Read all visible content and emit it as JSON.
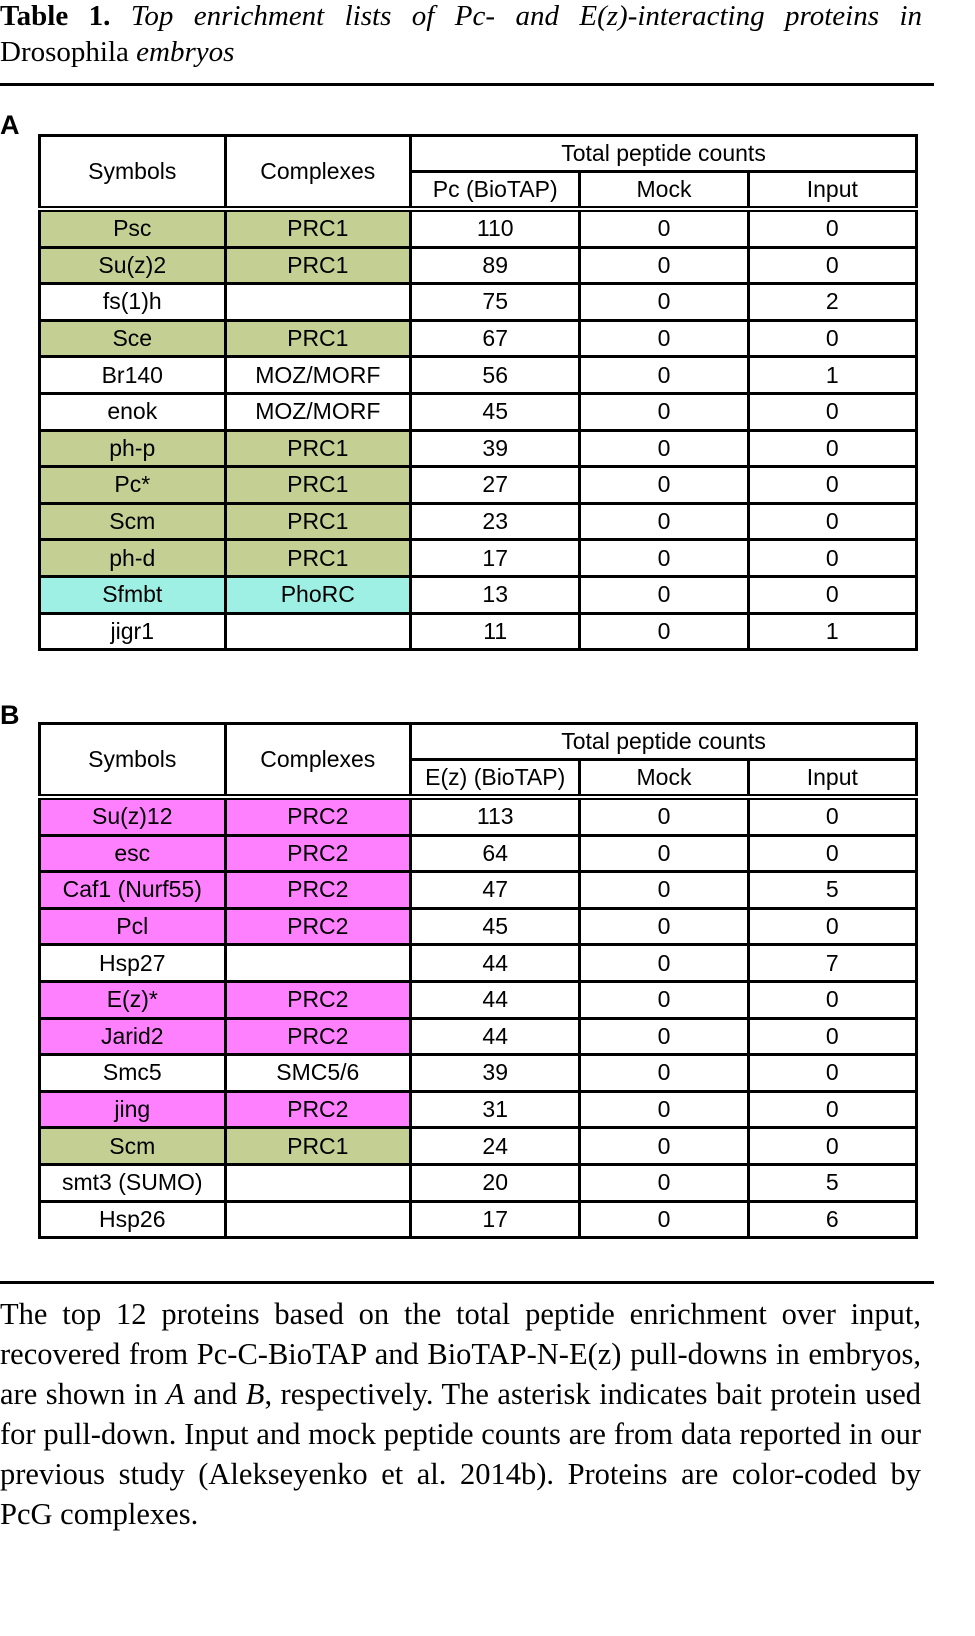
{
  "title": {
    "label": "Table 1.",
    "text_part1": "Top enrichment lists of Pc- and E(z)-interacting proteins in",
    "organism": "Drosophila",
    "text_part2": "embryos"
  },
  "legend": {
    "PRC1": "#c4cf93",
    "PRC2": "#ff80ff",
    "PhoRC": "#9ef0e4",
    "none": "#ffffff"
  },
  "panels": [
    {
      "label": "A",
      "headers": {
        "symbols": "Symbols",
        "complexes": "Complexes",
        "group": "Total peptide counts",
        "bait": "Pc (BioTAP)",
        "mock": "Mock",
        "input": "Input"
      },
      "rows": [
        {
          "symbol": "Psc",
          "complex": "PRC1",
          "bait": "110",
          "mock": "0",
          "input": "0",
          "color": "PRC1"
        },
        {
          "symbol": "Su(z)2",
          "complex": "PRC1",
          "bait": "89",
          "mock": "0",
          "input": "0",
          "color": "PRC1"
        },
        {
          "symbol": "fs(1)h",
          "complex": "",
          "bait": "75",
          "mock": "0",
          "input": "2",
          "color": "none"
        },
        {
          "symbol": "Sce",
          "complex": "PRC1",
          "bait": "67",
          "mock": "0",
          "input": "0",
          "color": "PRC1"
        },
        {
          "symbol": "Br140",
          "complex": "MOZ/MORF",
          "bait": "56",
          "mock": "0",
          "input": "1",
          "color": "none"
        },
        {
          "symbol": "enok",
          "complex": "MOZ/MORF",
          "bait": "45",
          "mock": "0",
          "input": "0",
          "color": "none"
        },
        {
          "symbol": "ph-p",
          "complex": "PRC1",
          "bait": "39",
          "mock": "0",
          "input": "0",
          "color": "PRC1"
        },
        {
          "symbol": "Pc*",
          "complex": "PRC1",
          "bait": "27",
          "mock": "0",
          "input": "0",
          "color": "PRC1"
        },
        {
          "symbol": "Scm",
          "complex": "PRC1",
          "bait": "23",
          "mock": "0",
          "input": "0",
          "color": "PRC1"
        },
        {
          "symbol": "ph-d",
          "complex": "PRC1",
          "bait": "17",
          "mock": "0",
          "input": "0",
          "color": "PRC1"
        },
        {
          "symbol": "Sfmbt",
          "complex": "PhoRC",
          "bait": "13",
          "mock": "0",
          "input": "0",
          "color": "PhoRC"
        },
        {
          "symbol": "jigr1",
          "complex": "",
          "bait": "11",
          "mock": "0",
          "input": "1",
          "color": "none"
        }
      ]
    },
    {
      "label": "B",
      "headers": {
        "symbols": "Symbols",
        "complexes": "Complexes",
        "group": "Total peptide counts",
        "bait": "E(z) (BioTAP)",
        "mock": "Mock",
        "input": "Input"
      },
      "rows": [
        {
          "symbol": "Su(z)12",
          "complex": "PRC2",
          "bait": "113",
          "mock": "0",
          "input": "0",
          "color": "PRC2"
        },
        {
          "symbol": "esc",
          "complex": "PRC2",
          "bait": "64",
          "mock": "0",
          "input": "0",
          "color": "PRC2"
        },
        {
          "symbol": "Caf1 (Nurf55)",
          "complex": "PRC2",
          "bait": "47",
          "mock": "0",
          "input": "5",
          "color": "PRC2"
        },
        {
          "symbol": "Pcl",
          "complex": "PRC2",
          "bait": "45",
          "mock": "0",
          "input": "0",
          "color": "PRC2"
        },
        {
          "symbol": "Hsp27",
          "complex": "",
          "bait": "44",
          "mock": "0",
          "input": "7",
          "color": "none"
        },
        {
          "symbol": "E(z)*",
          "complex": "PRC2",
          "bait": "44",
          "mock": "0",
          "input": "0",
          "color": "PRC2"
        },
        {
          "symbol": "Jarid2",
          "complex": "PRC2",
          "bait": "44",
          "mock": "0",
          "input": "0",
          "color": "PRC2"
        },
        {
          "symbol": "Smc5",
          "complex": "SMC5/6",
          "bait": "39",
          "mock": "0",
          "input": "0",
          "color": "none"
        },
        {
          "symbol": "jing",
          "complex": "PRC2",
          "bait": "31",
          "mock": "0",
          "input": "0",
          "color": "PRC2"
        },
        {
          "symbol": "Scm",
          "complex": "PRC1",
          "bait": "24",
          "mock": "0",
          "input": "0",
          "color": "PRC1"
        },
        {
          "symbol": "smt3 (SUMO)",
          "complex": "",
          "bait": "20",
          "mock": "0",
          "input": "5",
          "color": "none"
        },
        {
          "symbol": "Hsp26",
          "complex": "",
          "bait": "17",
          "mock": "0",
          "input": "6",
          "color": "none"
        }
      ]
    }
  ],
  "caption": {
    "part1": "The top 12 proteins based on the total peptide enrichment over input, recovered from Pc-C-BioTAP and BioTAP-N-E(z) pull-downs in embryos, are shown in",
    "ref_a": "A",
    "and": "and",
    "ref_b": "B",
    "part2": ", respectively. The asterisk indicates bait protein used for pull-down. Input and mock peptide counts are from data reported in our previ­ous study (Alekseyenko et al. 2014b). Proteins are color-coded by PcG complexes."
  }
}
